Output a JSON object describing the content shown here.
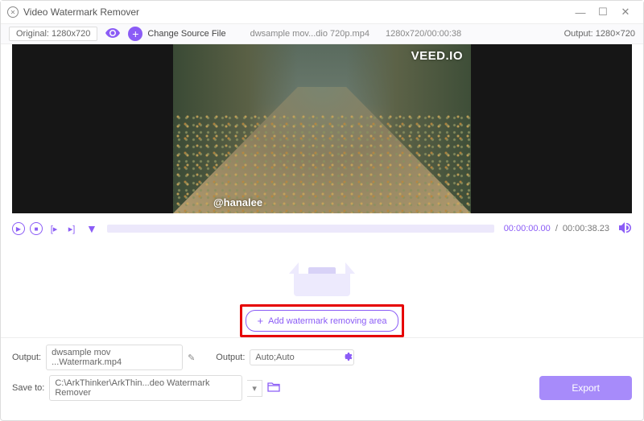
{
  "titlebar": {
    "title": "Video Watermark Remover"
  },
  "infobar": {
    "original_label": "Original: 1280x720",
    "change_source": "Change Source File",
    "filename": "dwsample mov...dio 720p.mp4",
    "dimensions_duration": "1280x720/00:00:38",
    "output_label": "Output: 1280×720"
  },
  "preview": {
    "watermark_top": "VEED.IO",
    "watermark_bottom": "@hanalee"
  },
  "controls": {
    "time_start": "00:00:00.00",
    "time_sep": "/",
    "time_total": "00:00:38.23"
  },
  "droparea": {
    "add_button": "Add watermark removing area"
  },
  "bottom": {
    "output_label": "Output:",
    "output_file": "dwsample mov ...Watermark.mp4",
    "output2_label": "Output:",
    "output_mode": "Auto;Auto",
    "saveto_label": "Save to:",
    "saveto_path": "C:\\ArkThinker\\ArkThin...deo Watermark Remover",
    "export": "Export"
  }
}
